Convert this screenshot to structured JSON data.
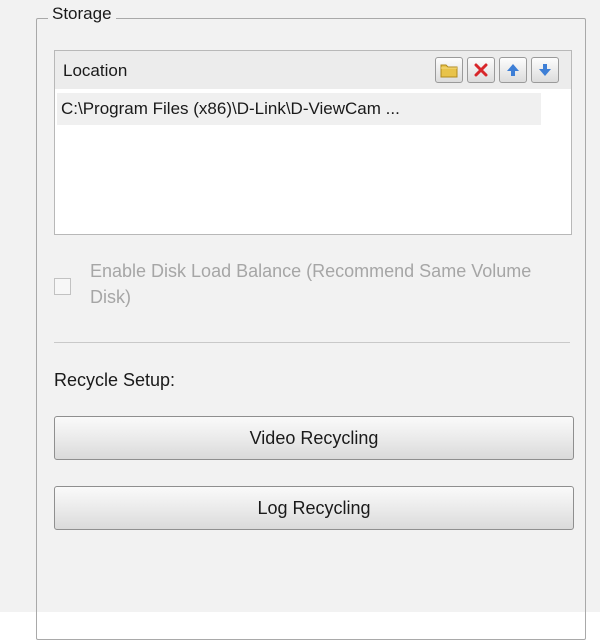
{
  "storage": {
    "group_title": "Storage",
    "location_header": "Location",
    "toolbar": {
      "add_icon": "folder-icon",
      "delete_icon": "delete-x-icon",
      "up_icon": "arrow-up-icon",
      "down_icon": "arrow-down-icon"
    },
    "locations": [
      "C:\\Program Files (x86)\\D-Link\\D-ViewCam ..."
    ],
    "disk_balance": {
      "label": "Enable Disk Load Balance (Recommend Same Volume Disk)",
      "checked": false,
      "enabled": false
    }
  },
  "recycle": {
    "section_label": "Recycle Setup:",
    "video_button": "Video Recycling",
    "log_button": "Log Recycling"
  },
  "colors": {
    "folder": "#e8c34a",
    "delete": "#d8262a",
    "arrow": "#3e7fd6"
  }
}
